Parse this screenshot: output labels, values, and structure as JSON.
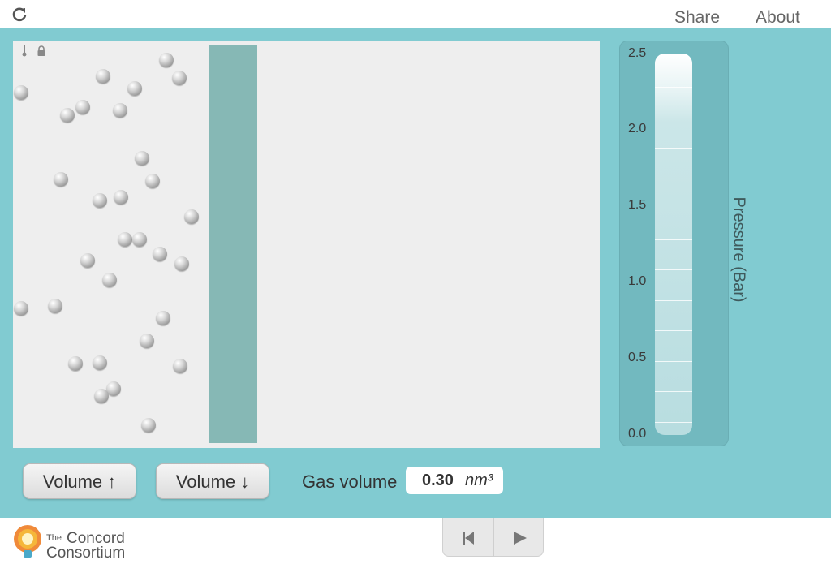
{
  "header": {
    "share_label": "Share",
    "about_label": "About"
  },
  "icons": {
    "reload": "reload-icon",
    "thermometer": "thermometer-icon",
    "lock": "lock-icon",
    "rewind": "rewind-icon",
    "play": "play-icon"
  },
  "gauge": {
    "label": "Pressure (Bar)",
    "ticks": [
      "2.5",
      "2.0",
      "1.5",
      "1.0",
      "0.5",
      "0.0"
    ]
  },
  "controls": {
    "volume_up_label": "Volume ↑",
    "volume_down_label": "Volume ↓",
    "gas_volume_label": "Gas volume",
    "gas_volume_value": "0.30",
    "gas_volume_unit": "nm³"
  },
  "footer": {
    "logo_the": "The",
    "logo_line1": "Concord",
    "logo_line2": "Consortium"
  },
  "colors": {
    "panel_bg": "#81cbd1",
    "piston": "#86b8b5",
    "sim_bg": "#eeeeee"
  }
}
